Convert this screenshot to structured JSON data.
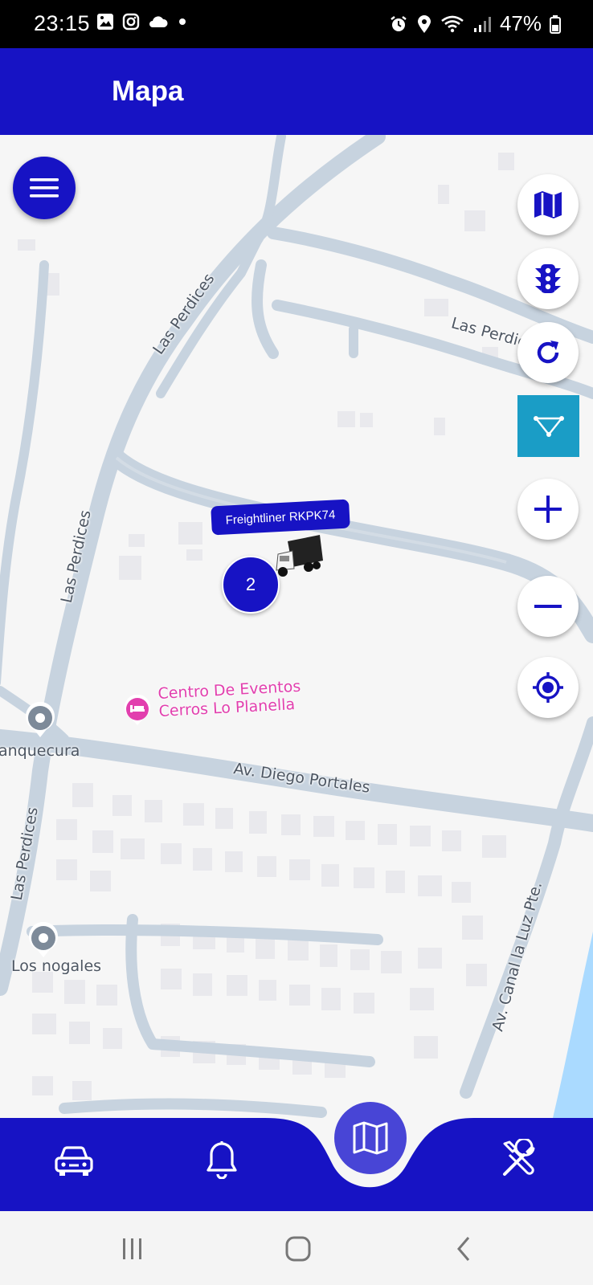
{
  "status_bar": {
    "time": "23:15",
    "battery": "47%",
    "icons_left": [
      "gallery-icon",
      "instagram-icon",
      "cloud-icon",
      "dot-icon"
    ],
    "icons_right": [
      "alarm-icon",
      "location-icon",
      "wifi-icon",
      "signal-icon",
      "battery-icon"
    ]
  },
  "app_bar": {
    "title": "Mapa",
    "color": "#1713c4"
  },
  "map": {
    "road_labels": [
      "Las Perdices",
      "Las Perdices",
      "Las Perdices",
      "Las Perdices",
      "Av. Diego Portales",
      "Av. Canal la Luz Pte."
    ],
    "poi": {
      "line1": "Centro De Eventos",
      "line2": "Cerros Lo Planella",
      "color": "#e23fae"
    },
    "places": [
      "anquecura",
      "Los nogales"
    ],
    "vehicle_label": "Freightliner RKPK74",
    "cluster_count": "2"
  },
  "controls": {
    "menu": "menu-icon",
    "layers": "map-icon",
    "traffic": "traffic-light-icon",
    "refresh": "refresh-icon",
    "filter": "triangle-icon",
    "zoom_in": "plus-icon",
    "zoom_out": "minus-icon",
    "locate": "crosshair-icon",
    "filter_color": "#1a9dc6"
  },
  "bottom_nav": {
    "items": [
      "car-icon",
      "bell-icon",
      "map-icon",
      "tools-icon"
    ],
    "active": "map-icon",
    "active_color": "#4845d6"
  },
  "system_nav": [
    "recent-apps-icon",
    "home-icon",
    "back-icon"
  ]
}
